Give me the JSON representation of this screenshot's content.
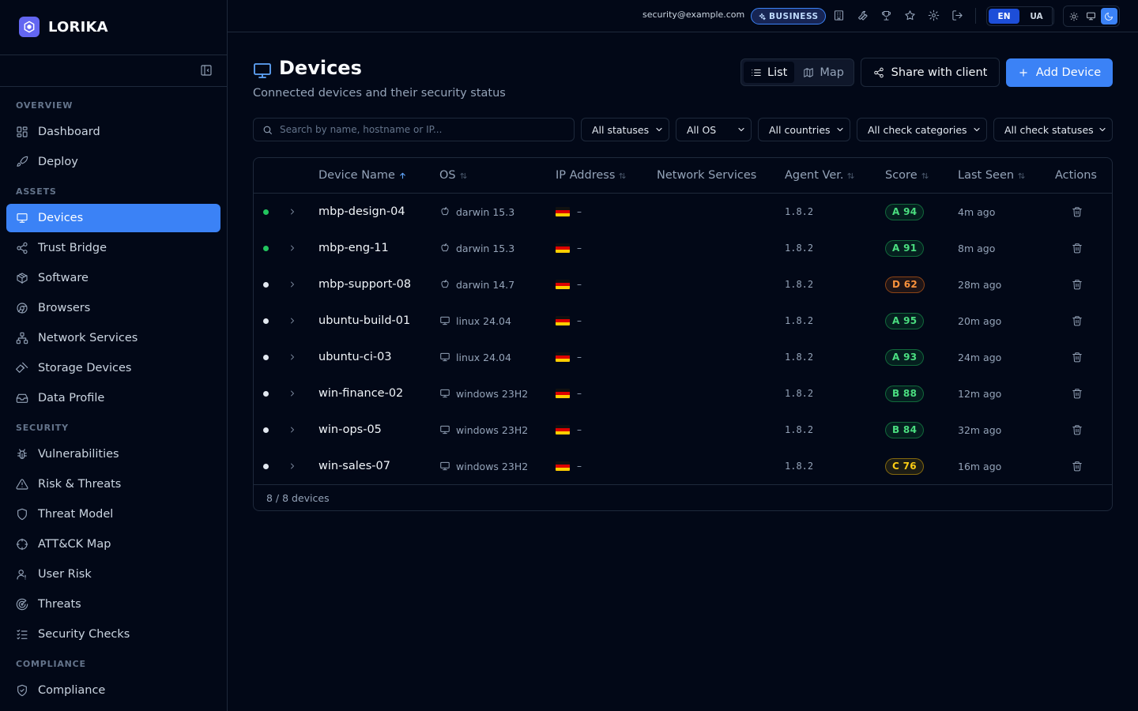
{
  "app": {
    "name": "LORIKA"
  },
  "topbar": {
    "email": "security@example.com",
    "plan": "BUSINESS",
    "langs": [
      "EN",
      "UA"
    ],
    "active_lang": "EN",
    "theme": "dark"
  },
  "sidebar": {
    "sections": [
      {
        "label": "OVERVIEW",
        "items": [
          {
            "label": "Dashboard",
            "icon": "dashboard-icon"
          },
          {
            "label": "Deploy",
            "icon": "rocket-icon"
          }
        ]
      },
      {
        "label": "ASSETS",
        "items": [
          {
            "label": "Devices",
            "icon": "monitor-icon",
            "active": true
          },
          {
            "label": "Trust Bridge",
            "icon": "share-nodes-icon"
          },
          {
            "label": "Software",
            "icon": "package-icon"
          },
          {
            "label": "Browsers",
            "icon": "browser-icon"
          },
          {
            "label": "Network Services",
            "icon": "network-icon"
          },
          {
            "label": "Storage Devices",
            "icon": "usb-icon"
          },
          {
            "label": "Data Profile",
            "icon": "inbox-icon"
          }
        ]
      },
      {
        "label": "SECURITY",
        "items": [
          {
            "label": "Vulnerabilities",
            "icon": "bug-icon"
          },
          {
            "label": "Risk & Threats",
            "icon": "warning-icon"
          },
          {
            "label": "Threat Model",
            "icon": "shield-icon"
          },
          {
            "label": "ATT&CK Map",
            "icon": "crosshair-icon"
          },
          {
            "label": "User Risk",
            "icon": "user-icon"
          },
          {
            "label": "Threats",
            "icon": "radar-icon"
          },
          {
            "label": "Security Checks",
            "icon": "checklist-icon"
          }
        ]
      },
      {
        "label": "COMPLIANCE",
        "items": [
          {
            "label": "Compliance",
            "icon": "shield-check-icon"
          }
        ]
      }
    ]
  },
  "page": {
    "title": "Devices",
    "subtitle": "Connected devices and their security status",
    "view_toggle": {
      "list": "List",
      "map": "Map",
      "active": "list"
    },
    "share_button": "Share with client",
    "add_button": "Add Device"
  },
  "filters": {
    "search_placeholder": "Search by name, hostname or IP...",
    "selects": [
      "All statuses",
      "All OS",
      "All countries",
      "All check categories",
      "All check statuses"
    ]
  },
  "table": {
    "columns": [
      "Device Name",
      "OS",
      "IP Address",
      "Network Services",
      "Agent Ver.",
      "Score",
      "Last Seen",
      "Actions"
    ],
    "sorted_by": "Device Name",
    "rows": [
      {
        "status": "online",
        "name": "mbp-design-04",
        "os_icon": "apple-icon",
        "os": "darwin 15.3",
        "country": "DE",
        "ip": "–",
        "agent": "1.8.2",
        "score": "A 94",
        "grade": "A",
        "last_seen": "4m ago"
      },
      {
        "status": "online",
        "name": "mbp-eng-11",
        "os_icon": "apple-icon",
        "os": "darwin 15.3",
        "country": "DE",
        "ip": "–",
        "agent": "1.8.2",
        "score": "A 91",
        "grade": "A",
        "last_seen": "8m ago"
      },
      {
        "status": "offline",
        "name": "mbp-support-08",
        "os_icon": "apple-icon",
        "os": "darwin 14.7",
        "country": "DE",
        "ip": "–",
        "agent": "1.8.2",
        "score": "D 62",
        "grade": "D",
        "last_seen": "28m ago"
      },
      {
        "status": "offline",
        "name": "ubuntu-build-01",
        "os_icon": "monitor-icon",
        "os": "linux 24.04",
        "country": "DE",
        "ip": "–",
        "agent": "1.8.2",
        "score": "A 95",
        "grade": "A",
        "last_seen": "20m ago"
      },
      {
        "status": "offline",
        "name": "ubuntu-ci-03",
        "os_icon": "monitor-icon",
        "os": "linux 24.04",
        "country": "DE",
        "ip": "–",
        "agent": "1.8.2",
        "score": "A 93",
        "grade": "A",
        "last_seen": "24m ago"
      },
      {
        "status": "offline",
        "name": "win-finance-02",
        "os_icon": "monitor-icon",
        "os": "windows 23H2",
        "country": "DE",
        "ip": "–",
        "agent": "1.8.2",
        "score": "B 88",
        "grade": "B",
        "last_seen": "12m ago"
      },
      {
        "status": "offline",
        "name": "win-ops-05",
        "os_icon": "monitor-icon",
        "os": "windows 23H2",
        "country": "DE",
        "ip": "–",
        "agent": "1.8.2",
        "score": "B 84",
        "grade": "B",
        "last_seen": "32m ago"
      },
      {
        "status": "offline",
        "name": "win-sales-07",
        "os_icon": "monitor-icon",
        "os": "windows 23H2",
        "country": "DE",
        "ip": "–",
        "agent": "1.8.2",
        "score": "C 76",
        "grade": "C",
        "last_seen": "16m ago"
      }
    ],
    "footer": "8 / 8 devices"
  },
  "colors": {
    "accent": "#3b82f6",
    "status_online": "#22c55e",
    "status_offline": "#e2e8f0",
    "grade_A": "#22c55e",
    "grade_B": "#22c55e",
    "grade_C": "#eab308",
    "grade_D": "#f97316"
  }
}
